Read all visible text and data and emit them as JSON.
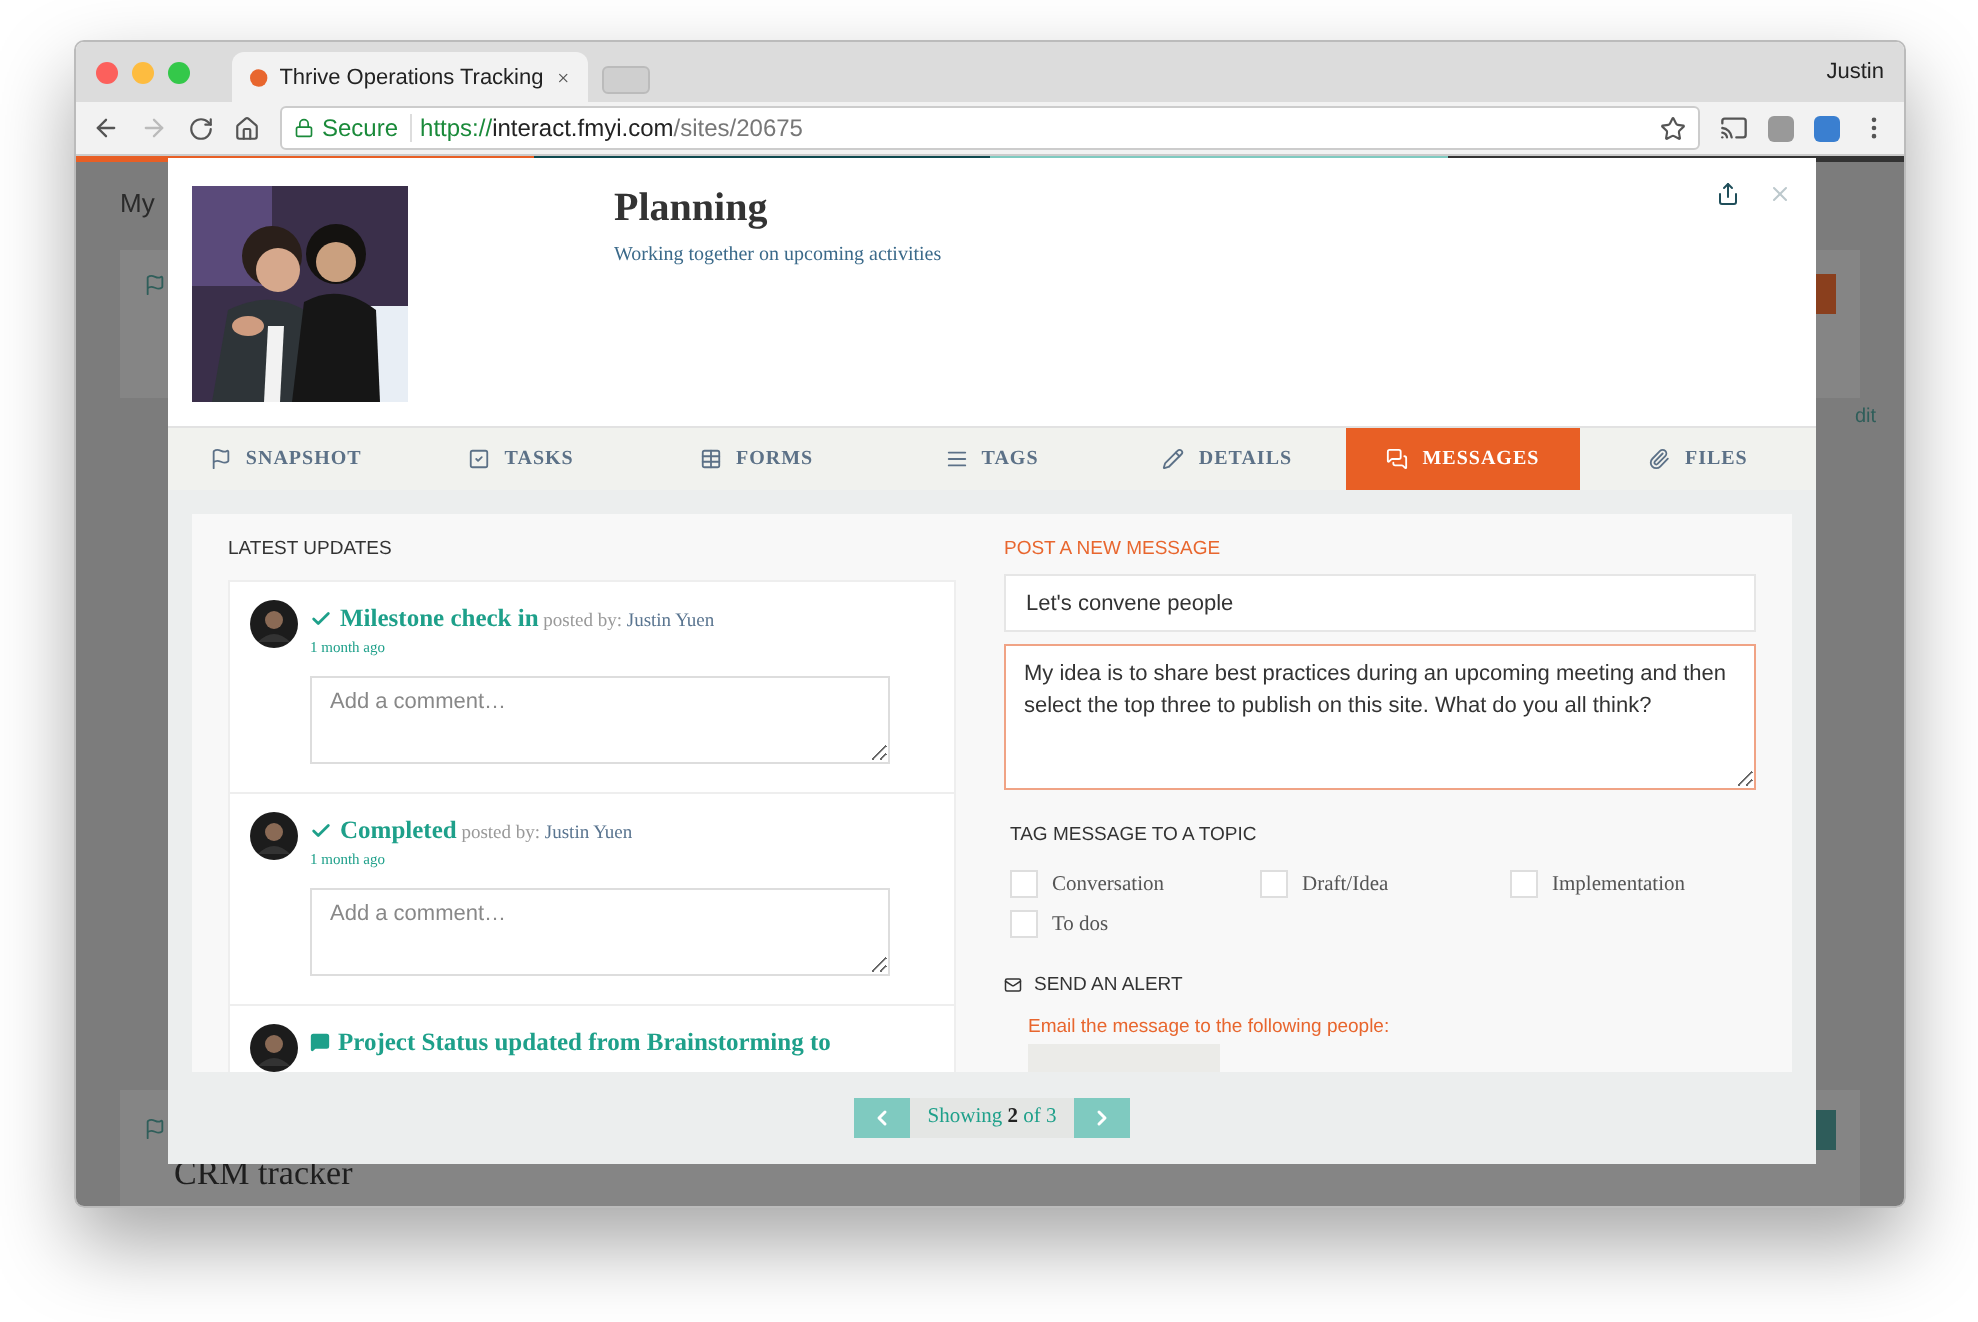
{
  "browser": {
    "tab_title": "Thrive Operations Tracking",
    "user": "Justin",
    "secure_label": "Secure",
    "url_scheme": "https://",
    "url_host": "interact.fmyi.com",
    "url_path": "/sites/20675"
  },
  "background_page": {
    "heading": "My",
    "edit_link": "dit",
    "card_title": "CRM tracker"
  },
  "modal": {
    "title": "Planning",
    "subtitle": "Working together on upcoming activities",
    "tabs": [
      {
        "label": "SNAPSHOT",
        "selected": false
      },
      {
        "label": "TASKS",
        "selected": false
      },
      {
        "label": "FORMS",
        "selected": false
      },
      {
        "label": "TAGS",
        "selected": false
      },
      {
        "label": "DETAILS",
        "selected": false
      },
      {
        "label": "MESSAGES",
        "selected": true
      },
      {
        "label": "FILES",
        "selected": false
      }
    ],
    "updates": {
      "heading": "LATEST UPDATES",
      "items": [
        {
          "kind": "check",
          "title": "Milestone check in",
          "posted_by_label": "posted by:",
          "author": "Justin Yuen",
          "time": "1 month ago",
          "comment_placeholder": "Add a comment…"
        },
        {
          "kind": "check",
          "title": "Completed",
          "posted_by_label": "posted by:",
          "author": "Justin Yuen",
          "time": "1 month ago",
          "comment_placeholder": "Add a comment…"
        },
        {
          "kind": "comment",
          "title": "Project Status updated from Brainstorming to"
        }
      ]
    },
    "composer": {
      "heading": "POST A NEW MESSAGE",
      "subject": "Let's convene people",
      "body": "My idea is to share best practices during an upcoming meeting and then select the top three to publish on this site. What do you all think?",
      "tag_heading": "TAG MESSAGE TO A TOPIC",
      "topics": [
        {
          "label": "Conversation",
          "checked": false
        },
        {
          "label": "Draft/Idea",
          "checked": false
        },
        {
          "label": "Implementation",
          "checked": false
        },
        {
          "label": "To dos",
          "checked": false
        }
      ],
      "alert_heading": "SEND AN ALERT",
      "alert_hint": "Email the message to the following people:"
    },
    "pager": {
      "text": "Showing **2** of 3"
    }
  }
}
